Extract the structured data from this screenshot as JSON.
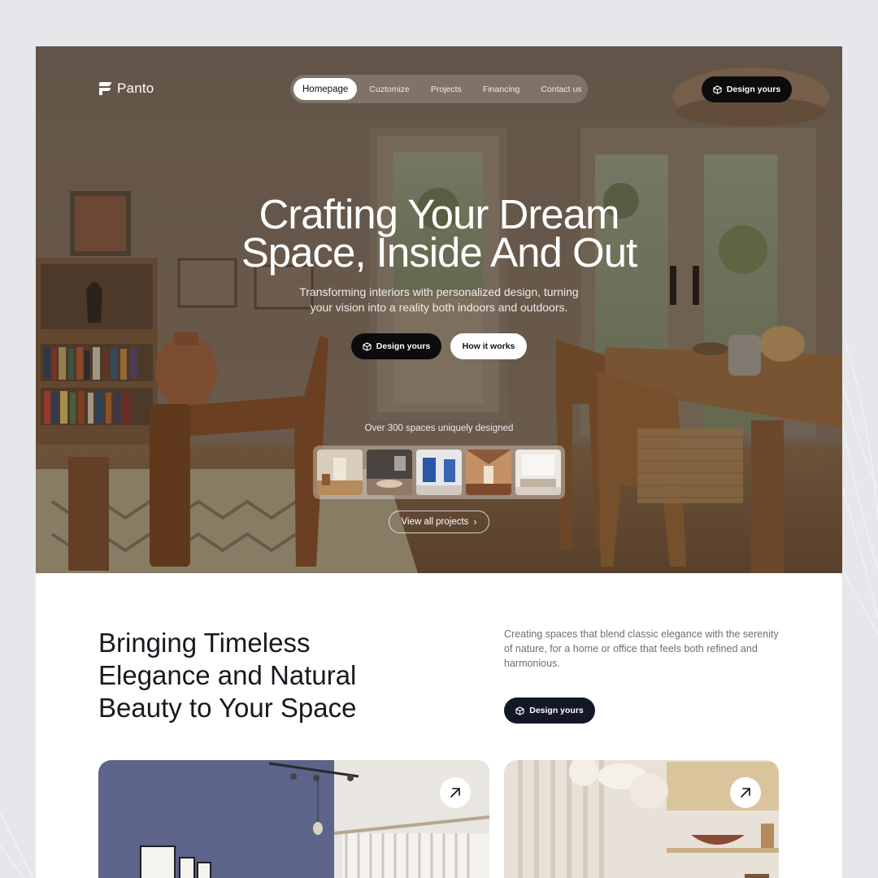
{
  "brand": {
    "name": "Panto"
  },
  "nav": {
    "items": [
      {
        "label": "Homepage",
        "active": true
      },
      {
        "label": "Cuztomize",
        "active": false
      },
      {
        "label": "Projects",
        "active": false
      },
      {
        "label": "Financing",
        "active": false
      },
      {
        "label": "Contact us",
        "active": false
      }
    ],
    "cta_label": "Design yours"
  },
  "hero": {
    "title_line1": "Crafting Your Dream",
    "title_line2": "Space, Inside And Out",
    "subtitle_line1": "Transforming interiors with personalized design, turning",
    "subtitle_line2": "your vision into a reality both indoors and outdoors.",
    "primary_label": "Design yours",
    "secondary_label": "How it works",
    "spaces_caption": "Over 300 spaces uniquely designed",
    "view_all_label": "View all projects"
  },
  "section": {
    "title_line1": "Bringing Timeless",
    "title_line2": "Elegance and Natural",
    "title_line3": "Beauty to Your Space",
    "description": "Creating spaces that blend classic elegance with the serenity of nature, for a home or office that feels both refined and harmonious.",
    "cta_label": "Design yours"
  },
  "icons": {
    "logo": "panto-logo-icon",
    "cube": "cube-icon",
    "chevron": "chevron-right-icon",
    "arrow": "arrow-up-right-icon"
  },
  "colors": {
    "dark_button": "#0c0c0e",
    "section_button": "#121826",
    "heading": "#17191f",
    "body_text": "#6b6e75"
  }
}
